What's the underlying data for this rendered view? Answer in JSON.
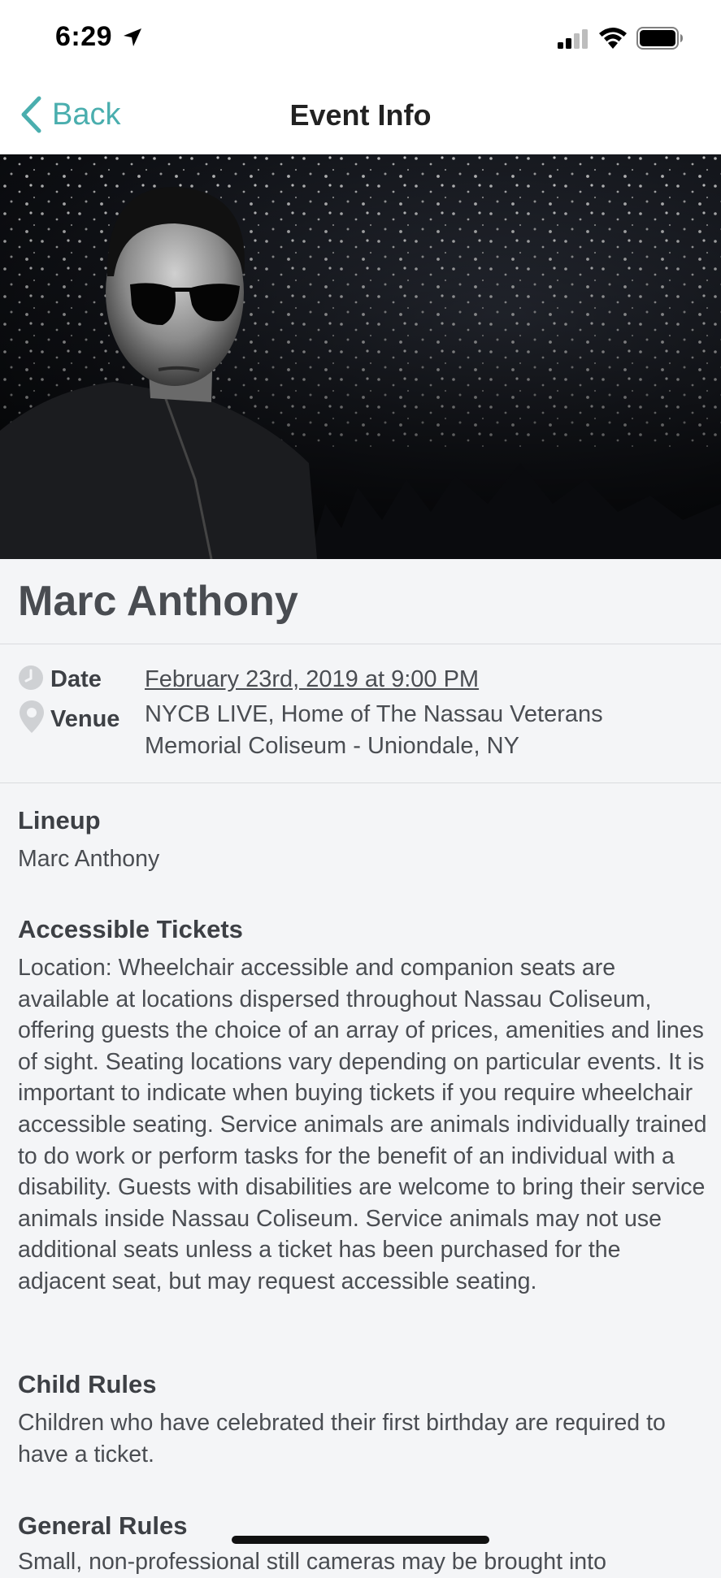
{
  "status_bar": {
    "time": "6:29"
  },
  "nav": {
    "back_label": "Back",
    "title": "Event Info"
  },
  "event": {
    "title": "Marc Anthony",
    "date_label": "Date",
    "date_value": "February 23rd, 2019 at 9:00 PM",
    "venue_label": "Venue",
    "venue_line1": "NYCB LIVE, Home of The Nassau Veterans",
    "venue_line2": "Memorial Coliseum - Uniondale, NY"
  },
  "sections": {
    "lineup": {
      "heading": "Lineup",
      "text": "Marc Anthony"
    },
    "accessible": {
      "heading": "Accessible Tickets",
      "text": "Location: Wheelchair accessible and companion seats are available at locations dispersed throughout Nassau Coliseum, offering guests the choice of an array of prices, amenities and lines of sight. Seating locations vary depending on particular events. It is important to indicate when buying tickets if you require wheelchair accessible seating. Service animals are animals individually trained to do work or perform tasks for the benefit of an individual with a disability. Guests with disabilities are welcome to bring their service animals inside Nassau Coliseum. Service animals may not use additional seats unless a ticket has been purchased for the adjacent seat, but may request accessible seating."
    },
    "child": {
      "heading": "Child Rules",
      "text": "Children who have celebrated their first birthday are required to have a ticket."
    },
    "general": {
      "heading": "General Rules",
      "text": "Small, non-professional still cameras may be brought into"
    }
  },
  "colors": {
    "accent": "#4aaeae",
    "background": "#f4f5f7"
  }
}
